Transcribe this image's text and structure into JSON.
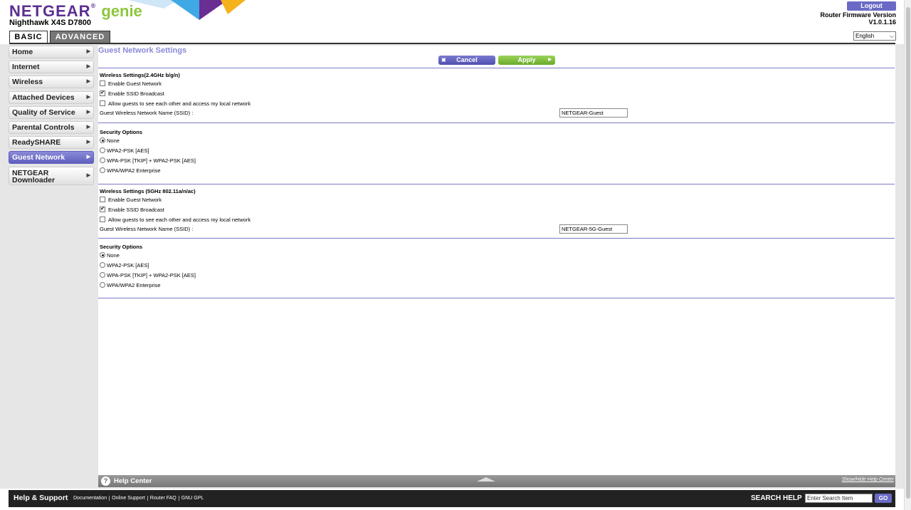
{
  "header": {
    "brand": "NETGEAR",
    "brand_suffix": "genie",
    "model": "Nighthawk X4S D7800",
    "logout_label": "Logout",
    "firmware_label": "Router Firmware Version",
    "firmware_version": "V1.0.1.16",
    "language_selected": "English",
    "tabs": [
      {
        "label": "BASIC",
        "active": true
      },
      {
        "label": "ADVANCED",
        "active": false
      }
    ]
  },
  "sidebar": {
    "items": [
      {
        "label": "Home"
      },
      {
        "label": "Internet"
      },
      {
        "label": "Wireless"
      },
      {
        "label": "Attached Devices"
      },
      {
        "label": "Quality of Service"
      },
      {
        "label": "Parental Controls"
      },
      {
        "label": "ReadySHARE"
      },
      {
        "label": "Guest Network",
        "active": true
      },
      {
        "label_line1": "NETGEAR",
        "label_line2": "Downloader"
      }
    ]
  },
  "main": {
    "title": "Guest Network Settings",
    "cancel_label": "Cancel",
    "apply_label": "Apply",
    "band24": {
      "heading": "Wireless Settings(2.4GHz b/g/n)",
      "enable_guest": {
        "label": "Enable Guest Network",
        "checked": false
      },
      "ssid_broadcast": {
        "label": "Enable SSID Broadcast",
        "checked": true
      },
      "allow_guests": {
        "label": "Allow guests to see each other and access my local network",
        "checked": false
      },
      "ssid_label": "Guest Wireless Network Name (SSID) :",
      "ssid_value": "NETGEAR-Guest",
      "security_heading": "Security Options",
      "security_options": [
        "None",
        "WPA2-PSK [AES]",
        "WPA-PSK [TKIP] + WPA2-PSK [AES]",
        "WPA/WPA2 Enterprise"
      ],
      "security_selected": "None"
    },
    "band5": {
      "heading": "Wireless Settings (5GHz 802.11a/n/ac)",
      "enable_guest": {
        "label": "Enable Guest Network",
        "checked": false
      },
      "ssid_broadcast": {
        "label": "Enable SSID Broadcast",
        "checked": true
      },
      "allow_guests": {
        "label": "Allow guests to see each other and access my local network",
        "checked": false
      },
      "ssid_label": "Guest Wireless Network Name (SSID) :",
      "ssid_value": "NETGEAR-5G-Guest",
      "security_heading": "Security Options",
      "security_options": [
        "None",
        "WPA2-PSK [AES]",
        "WPA-PSK [TKIP] + WPA2-PSK [AES]",
        "WPA/WPA2 Enterprise"
      ],
      "security_selected": "None"
    }
  },
  "help_center": {
    "title": "Help Center",
    "show_hide": "Show/Hide Help Center"
  },
  "footer": {
    "title": "Help & Support",
    "links": [
      "Documentation",
      "Online Support",
      "Router FAQ",
      "GNU GPL"
    ],
    "search_label": "SEARCH HELP",
    "search_placeholder": "Enter Search Item",
    "go_label": "GO"
  },
  "colors": {
    "brand_purple": "#5c2e91",
    "brand_green": "#8dc63f",
    "accent": "#6a6ac6",
    "apply_green": "#7cbf3a"
  }
}
